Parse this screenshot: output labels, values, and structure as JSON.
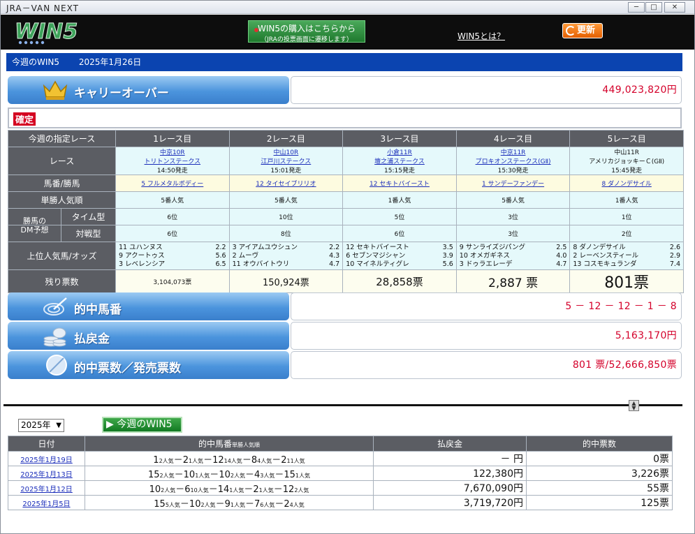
{
  "window": {
    "title": "JRA－VAN NEXT",
    "controls": [
      "─",
      "□",
      "✕"
    ]
  },
  "header": {
    "logo": "WIN5",
    "buy_button": {
      "line1": "WIN5の購入はこちらから",
      "line2": "（JRAの投票画面に遷移します）"
    },
    "about_link": "WIN5とは？",
    "refresh_label": "更新"
  },
  "week": {
    "label": "今週のWIN5",
    "date": "2025年1月26日"
  },
  "carryover": {
    "label": "キャリーオーバー",
    "value": "449,023,820円"
  },
  "status": "確定",
  "races": {
    "headers": [
      "今週の指定レース",
      "1レース目",
      "2レース目",
      "3レース目",
      "4レース目",
      "5レース目"
    ],
    "row_labels": {
      "race": "レース",
      "horse": "馬番/勝馬",
      "pop": "単勝人気順",
      "dm": "勝馬の\nDM予想",
      "time": "タイム型",
      "vs": "対戦型",
      "odds": "上位人気馬/オッズ",
      "remain": "残り票数"
    },
    "items": [
      {
        "venue": "中京10R",
        "name": "トリトンステークス",
        "start": "14:50発走",
        "winner": "5 フルメタルボディー",
        "pop": "5番人気",
        "time": "6位",
        "vs": "6位",
        "odds": [
          [
            "11 ユハンヌス",
            "2.2"
          ],
          [
            "9 アクートゥス",
            "5.6"
          ],
          [
            "3 レベレンシア",
            "6.5"
          ]
        ],
        "remain": "3,104,073票"
      },
      {
        "venue": "中山10R",
        "name": "江戸川ステークス",
        "start": "15:01発走",
        "winner": "12 タイセイブリリオ",
        "pop": "5番人気",
        "time": "10位",
        "vs": "8位",
        "odds": [
          [
            "3 アイアムユウシュン",
            "2.2"
          ],
          [
            "2 ムーヴ",
            "4.3"
          ],
          [
            "11 オウバイトウリ",
            "4.7"
          ]
        ],
        "remain": "150,924票"
      },
      {
        "venue": "小倉11R",
        "name": "壇之浦ステークス",
        "start": "15:15発走",
        "winner": "12 セキトバイースト",
        "pop": "1番人気",
        "time": "5位",
        "vs": "6位",
        "odds": [
          [
            "12 セキトバイースト",
            "3.5"
          ],
          [
            "6 セブンマジシャン",
            "3.9"
          ],
          [
            "10 マイネルティグレ",
            "5.6"
          ]
        ],
        "remain": "28,858票"
      },
      {
        "venue": "中京11R",
        "name": "プロキオンステークス(GⅡ)",
        "start": "15:30発走",
        "winner": "1 サンデーファンデー",
        "pop": "5番人気",
        "time": "3位",
        "vs": "3位",
        "odds": [
          [
            "9 サンライズジパング",
            "2.5"
          ],
          [
            "10 オメガギネス",
            "4.0"
          ],
          [
            "3 ドゥラエレーデ",
            "4.7"
          ]
        ],
        "remain": "2,887 票"
      },
      {
        "venue": "中山11R",
        "name": "アメリカジョッキーＣ(GⅡ)",
        "start": "15:45発走",
        "winner": "8 ダノンデサイル",
        "pop": "1番人気",
        "time": "1位",
        "vs": "2位",
        "odds": [
          [
            "8 ダノンデサイル",
            "2.6"
          ],
          [
            "2 レーベンスティール",
            "2.9"
          ],
          [
            "13 コスモキュランダ",
            "7.4"
          ]
        ],
        "remain": "801票"
      }
    ]
  },
  "results": {
    "winning": {
      "label": "的中馬番",
      "value": "5 － 12 － 12 － 1 － 8"
    },
    "payout": {
      "label": "払戻金",
      "value": "5,163,170円"
    },
    "tickets": {
      "label": "的中票数／発売票数",
      "value": "801 票/52,666,850票"
    }
  },
  "history": {
    "year_select": "2025年",
    "this_week_button": "今週のWIN5",
    "headers": [
      "日付",
      "的中馬番",
      "単勝人気順",
      "払戻金",
      "的中票数"
    ],
    "rows": [
      {
        "date": "2025年1月19日",
        "seq": [
          [
            "1",
            "2人気"
          ],
          [
            "2",
            "1人気"
          ],
          [
            "12",
            "14人気"
          ],
          [
            "8",
            "4人気"
          ],
          [
            "2",
            "11人気"
          ]
        ],
        "payout": "－ 円",
        "hits": "0票"
      },
      {
        "date": "2025年1月13日",
        "seq": [
          [
            "15",
            "2人気"
          ],
          [
            "10",
            "1人気"
          ],
          [
            "10",
            "2人気"
          ],
          [
            "4",
            "3人気"
          ],
          [
            "15",
            "1人気"
          ]
        ],
        "payout": "122,380円",
        "hits": "3,226票"
      },
      {
        "date": "2025年1月12日",
        "seq": [
          [
            "10",
            "2人気"
          ],
          [
            "6",
            "10人気"
          ],
          [
            "14",
            "1人気"
          ],
          [
            "2",
            "1人気"
          ],
          [
            "12",
            "2人気"
          ]
        ],
        "payout": "7,670,090円",
        "hits": "55票"
      },
      {
        "date": "2025年1月5日",
        "seq": [
          [
            "15",
            "5人気"
          ],
          [
            "10",
            "2人気"
          ],
          [
            "9",
            "1人気"
          ],
          [
            "7",
            "6人気"
          ],
          [
            "2",
            "4人気"
          ]
        ],
        "payout": "3,719,720円",
        "hits": "125票"
      }
    ]
  },
  "colors": {
    "accent_blue": "#0b44b0",
    "value_red": "#d4002a",
    "header_gray": "#5b5d63"
  }
}
